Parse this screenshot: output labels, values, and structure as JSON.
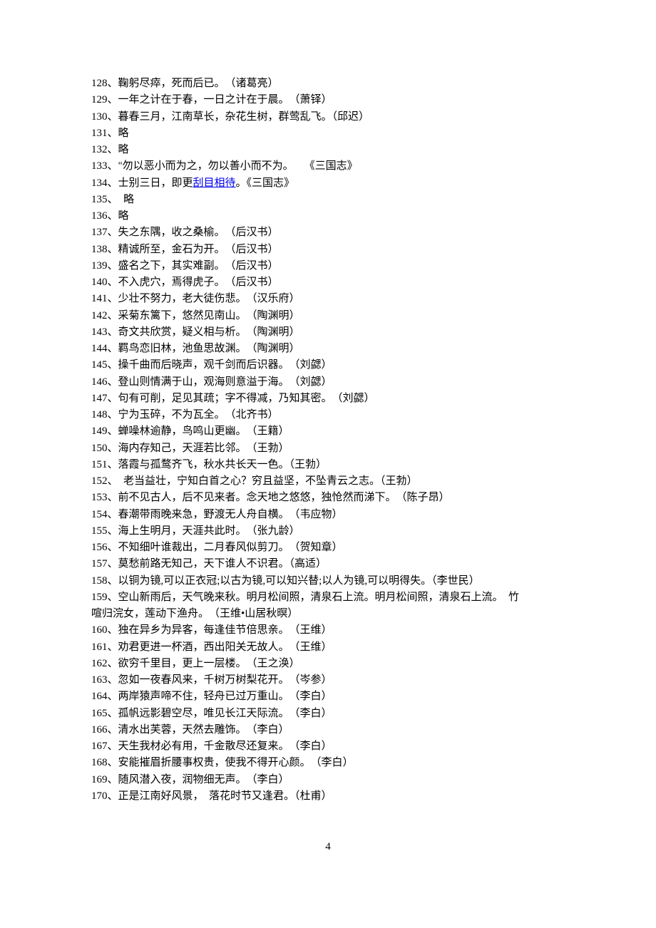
{
  "lines": [
    {
      "num": "128",
      "text": "鞠躬尽瘁，死而后已。　（诸葛亮）"
    },
    {
      "num": "129",
      "text": "一年之计在于春，一日之计在于晨。　（萧铎）"
    },
    {
      "num": "130",
      "text": "暮春三月，江南草长，杂花生树，群莺乱飞。（邱迟）"
    },
    {
      "num": "131",
      "text": "略"
    },
    {
      "num": "132",
      "text": "略"
    },
    {
      "num": "133",
      "text": "\"勿以恶小而为之，勿以善小而不为。　　《三国志》"
    },
    {
      "num": "134",
      "pre": "士别三日，即更",
      "link": "刮目相待",
      "post": "。《三国志》"
    },
    {
      "num": "135",
      "text": "　略"
    },
    {
      "num": "136",
      "text": "略"
    },
    {
      "num": "137",
      "text": "失之东隅，收之桑榆。　（后汉书）"
    },
    {
      "num": "138",
      "text": "精诚所至，金石为开。　（后汉书）"
    },
    {
      "num": "139",
      "text": "盛名之下，其实难副。　（后汉书）"
    },
    {
      "num": "140",
      "text": "不入虎穴，焉得虎子。　（后汉书）"
    },
    {
      "num": "141",
      "text": "少壮不努力，老大徒伤悲。　（汉乐府）"
    },
    {
      "num": "142",
      "text": "采菊东篱下，悠然见南山。　（陶渊明）"
    },
    {
      "num": "143",
      "text": "奇文共欣赏，疑义相与析。　（陶渊明）"
    },
    {
      "num": "144",
      "text": "羁鸟恋旧林，池鱼思故渊。　（陶渊明）"
    },
    {
      "num": "145",
      "text": "操千曲而后晓声，观千剑而后识器。　（刘勰）"
    },
    {
      "num": "146",
      "text": "登山则情满于山，观海则意溢于海。　（刘勰）"
    },
    {
      "num": "147",
      "text": "句有可削，足见其疏；字不得减，乃知其密。　（刘勰）"
    },
    {
      "num": "148",
      "text": "宁为玉碎，不为瓦全。　（北齐书）"
    },
    {
      "num": "149",
      "text": "蝉噪林逾静，鸟鸣山更幽。　（王籍）"
    },
    {
      "num": "150",
      "text": "海内存知己，天涯若比邻。　（王勃）"
    },
    {
      "num": "151",
      "text": "落霞与孤鹜齐飞，秋水共长天一色。（王勃）"
    },
    {
      "num": "152",
      "text": "　老当益壮，宁知白首之心？穷且益坚，不坠青云之志。（王勃）"
    },
    {
      "num": "153",
      "text": "前不见古人，后不见来者。念天地之悠悠，独怆然而涕下。　（陈子昂）"
    },
    {
      "num": "154",
      "text": "春潮带雨晚来急，野渡无人舟自横。　（韦应物）"
    },
    {
      "num": "155",
      "text": "海上生明月，天涯共此时。　（张九龄）"
    },
    {
      "num": "156",
      "text": "不知细叶谁裁出，二月春风似剪刀。　（贺知章）"
    },
    {
      "num": "157",
      "text": "莫愁前路无知己，天下谁人不识君。（高适）"
    },
    {
      "num": "158",
      "text": "以铜为镜,可以正衣冠;以古为镜,可以知兴替;以人为镜,可以明得失。（李世民）"
    },
    {
      "num": "159",
      "text": "空山新雨后，天气晚来秋。明月松间照，清泉石上流。明月松间照，清泉石上流。　竹"
    },
    {
      "cont": true,
      "text": "喧归浣女，莲动下渔舟。　（王维•山居秋暝）"
    },
    {
      "num": "160",
      "text": "独在异乡为异客，每逢佳节倍思亲。　（王维）"
    },
    {
      "num": "161",
      "text": "劝君更进一杯酒，西出阳关无故人。　（王维）"
    },
    {
      "num": "162",
      "text": "欲穷千里目，更上一层楼。　（王之涣）"
    },
    {
      "num": "163",
      "text": "忽如一夜春风来，千树万树梨花开。　（岑参）"
    },
    {
      "num": "164",
      "text": "两岸猿声啼不住，轻舟已过万重山。　（李白）"
    },
    {
      "num": "165",
      "text": "孤帆远影碧空尽，唯见长江天际流。　（李白）"
    },
    {
      "num": "166",
      "text": "清水出芙蓉，天然去雕饰。　（李白）"
    },
    {
      "num": "167",
      "text": "天生我材必有用，千金散尽还复来。　（李白）"
    },
    {
      "num": "168",
      "text": "安能摧眉折腰事权贵，使我不得开心颜。　（李白）"
    },
    {
      "num": "169",
      "text": "随风潜入夜，润物细无声。　（李白）"
    },
    {
      "num": "170",
      "text": "正是江南好风景，　落花时节又逢君。（杜甫）"
    }
  ],
  "page_number": "4"
}
